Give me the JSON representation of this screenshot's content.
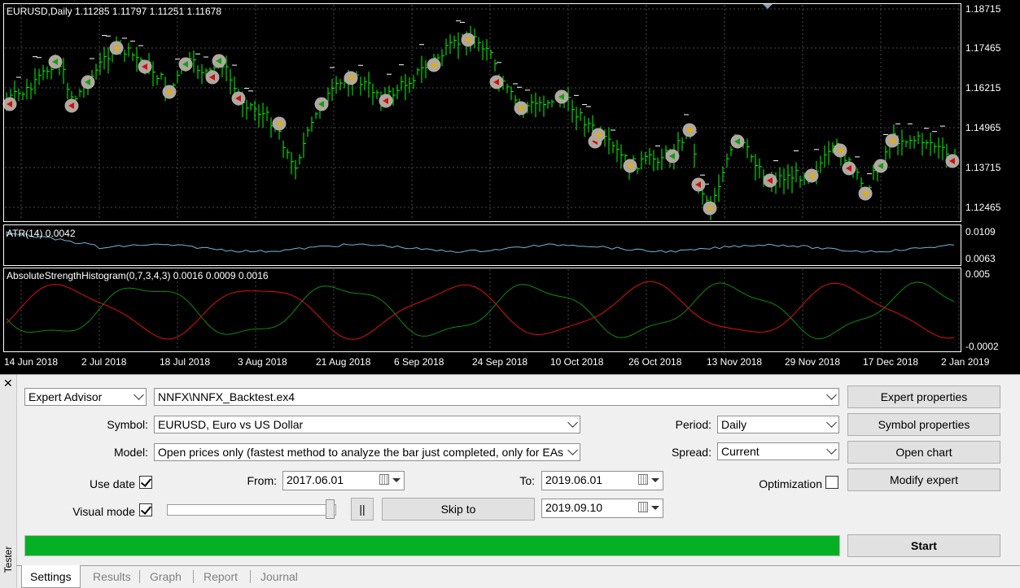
{
  "chart": {
    "symbol_info": "EURUSD,Daily  1.11285 1.11797 1.11251 1.11678",
    "atr_label": "ATR(14) 0.0042",
    "ash_label": "AbsoluteStrengthHistogram(0,7,3,4,3) 0.0016 0.0009 0.0016",
    "price_axis": [
      "1.18715",
      "1.17465",
      "1.16215",
      "1.14965",
      "1.13715",
      "1.12465"
    ],
    "atr_axis": [
      "0.0109",
      "0.0063"
    ],
    "ash_axis": [
      "0.005",
      "-0.0002"
    ],
    "dates": [
      "14 Jun 2018",
      "2 Jul 2018",
      "18 Jul 2018",
      "3 Aug 2018",
      "21 Aug 2018",
      "6 Sep 2018",
      "24 Sep 2018",
      "10 Oct 2018",
      "26 Oct 2018",
      "13 Nov 2018",
      "29 Nov 2018",
      "17 Dec 2018",
      "2 Jan 2019"
    ],
    "colors": {
      "background": "#000000",
      "candle": "#00ff00",
      "grid": "#4a4a4a",
      "atr_line": "#6fb7d6",
      "ash_bull": "#0e8a0e",
      "ash_bear": "#e01010",
      "trade_marker": "#b0a8a0"
    }
  },
  "tester": {
    "title": "Tester",
    "mode": "Expert Advisor",
    "expert_file": "NNFX\\NNFX_Backtest.ex4",
    "symbol_label": "Symbol:",
    "symbol_value": "EURUSD, Euro vs US Dollar",
    "model_label": "Model:",
    "model_value": "Open prices only (fastest method to analyze the bar just completed, only for EAs that",
    "use_date_label": "Use date",
    "use_date_checked": true,
    "from_label": "From:",
    "from_value": "2017.06.01",
    "to_label": "To:",
    "to_value": "2019.06.01",
    "visual_mode_label": "Visual mode",
    "visual_mode_checked": true,
    "pause_label": "||",
    "skip_to_label": "Skip to",
    "skip_to_value": "2019.09.10",
    "period_label": "Period:",
    "period_value": "Daily",
    "spread_label": "Spread:",
    "spread_value": "Current",
    "optimization_label": "Optimization",
    "optimization_checked": false,
    "buttons": {
      "expert_properties": "Expert properties",
      "symbol_properties": "Symbol properties",
      "open_chart": "Open chart",
      "modify_expert": "Modify expert",
      "start": "Start"
    },
    "progress_percent": 100,
    "tabs": [
      "Settings",
      "Results",
      "Graph",
      "Report",
      "Journal"
    ],
    "active_tab": "Settings"
  }
}
